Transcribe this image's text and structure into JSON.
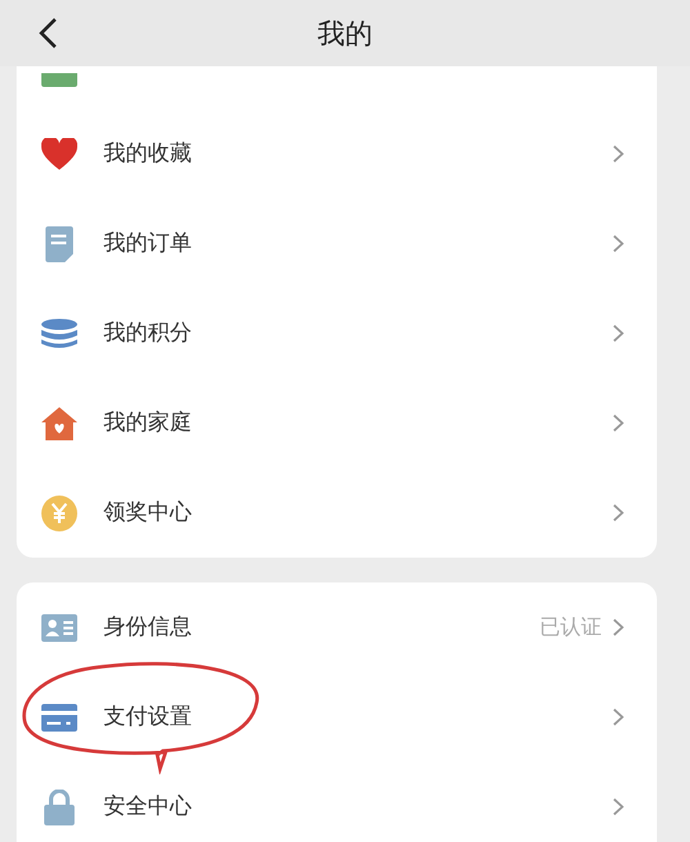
{
  "header": {
    "title": "我的"
  },
  "sections": [
    {
      "items": [
        {
          "label": "我的收藏",
          "highlighted": false
        },
        {
          "label": "我的订单",
          "highlighted": false
        },
        {
          "label": "我的积分",
          "highlighted": false
        },
        {
          "label": "我的家庭",
          "highlighted": false
        },
        {
          "label": "领奖中心",
          "highlighted": false
        }
      ]
    },
    {
      "items": [
        {
          "label": "身份信息",
          "value": "已认证",
          "highlighted": false
        },
        {
          "label": "支付设置",
          "highlighted": true
        },
        {
          "label": "安全中心",
          "highlighted": false
        }
      ]
    }
  ]
}
